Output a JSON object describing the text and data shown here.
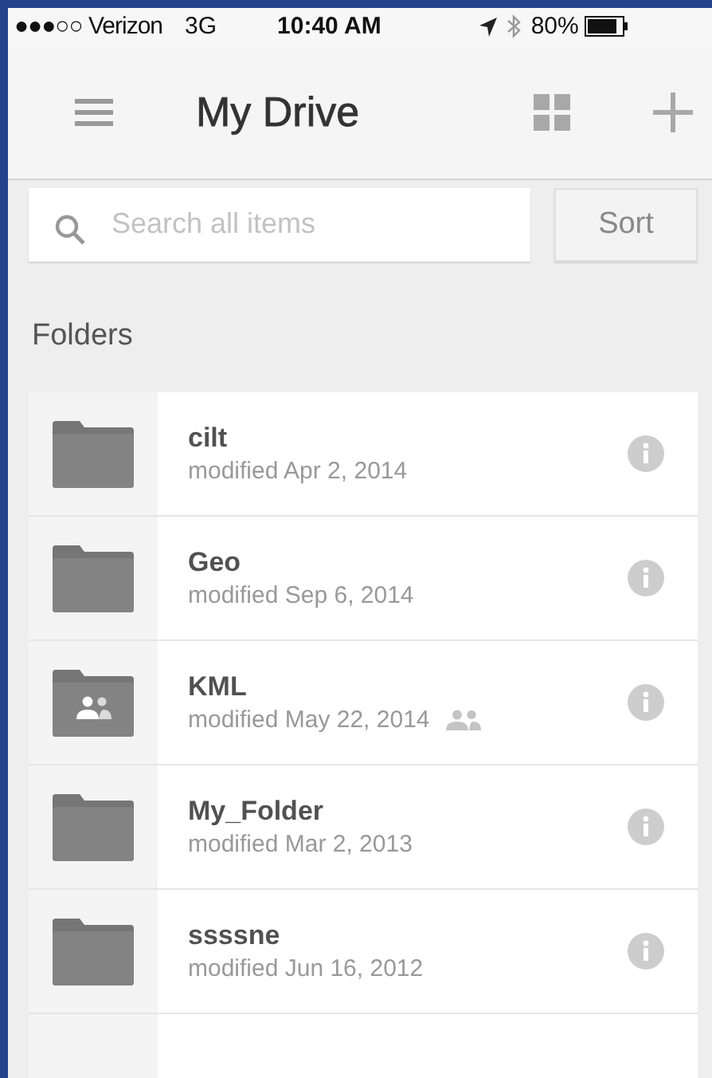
{
  "status_bar": {
    "carrier": "●●●○○ Verizon",
    "network": "3G",
    "time": "10:40 AM",
    "battery": "80%"
  },
  "header": {
    "title": "My Drive"
  },
  "search": {
    "placeholder": "Search all items"
  },
  "sort_button": "Sort",
  "section_title": "Folders",
  "folders": [
    {
      "name": "cilt",
      "modified": "modified Apr 2, 2014",
      "shared": false
    },
    {
      "name": "Geo",
      "modified": "modified Sep 6, 2014",
      "shared": false
    },
    {
      "name": "KML",
      "modified": "modified May 22, 2014",
      "shared": true
    },
    {
      "name": "My_Folder",
      "modified": "modified Mar 2, 2013",
      "shared": false
    },
    {
      "name": "ssssne",
      "modified": "modified Jun 16, 2012",
      "shared": false
    }
  ]
}
